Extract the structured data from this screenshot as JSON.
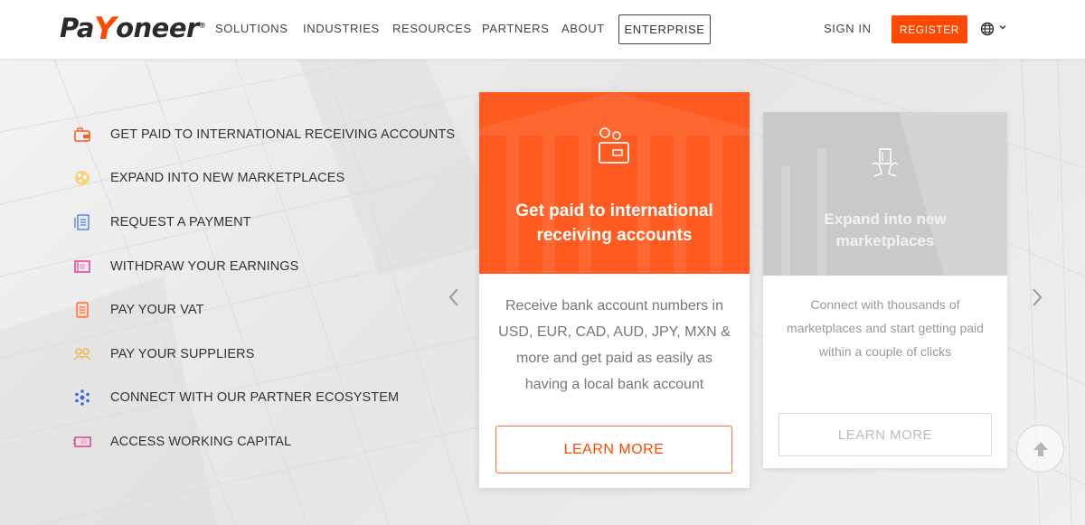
{
  "brand": {
    "logo_prefix": "Pa",
    "logo_y": "Y",
    "logo_suffix": "oneer",
    "logo_reg": "®",
    "accent": "#ff4800",
    "card_orange": "#ff5a1f",
    "card_grey": "#c9c9cb"
  },
  "nav": {
    "items": [
      "SOLUTIONS",
      "INDUSTRIES",
      "RESOURCES",
      "PARTNERS",
      "ABOUT"
    ],
    "enterprise": "ENTERPRISE",
    "sign_in": "SIGN IN",
    "register": "REGISTER",
    "language_icon": "globe-icon"
  },
  "solutions": [
    {
      "label": "GET PAID TO INTERNATIONAL RECEIVING ACCOUNTS",
      "icon": "wallet-icon",
      "color": "#ff5a1f"
    },
    {
      "label": "EXPAND INTO NEW MARKETPLACES",
      "icon": "globe-dots-icon",
      "color": "#f5b73b"
    },
    {
      "label": "REQUEST A PAYMENT",
      "icon": "document-request-icon",
      "color": "#5b7fd6"
    },
    {
      "label": "WITHDRAW YOUR EARNINGS",
      "icon": "withdraw-icon",
      "color": "#e0418f"
    },
    {
      "label": "PAY YOUR VAT",
      "icon": "receipt-icon",
      "color": "#ff6a35"
    },
    {
      "label": "PAY YOUR SUPPLIERS",
      "icon": "suppliers-icon",
      "color": "#f5b73b"
    },
    {
      "label": "CONNECT WITH OUR PARTNER ECOSYSTEM",
      "icon": "network-icon",
      "color": "#3b6cd6"
    },
    {
      "label": "ACCESS WORKING CAPITAL",
      "icon": "cash-icon",
      "color": "#e0418f"
    }
  ],
  "cards": {
    "main": {
      "title": "Get paid to international receiving accounts",
      "description": "Receive bank account numbers in USD, EUR, CAD, AUD, JPY, MXN & more and get paid as easily as having a local bank account",
      "cta": "LEARN MORE",
      "icon": "wallet-icon"
    },
    "side": {
      "title": "Expand into new marketplaces",
      "description": "Connect with thousands of marketplaces and start getting paid within a couple of clicks",
      "cta": "LEARN MORE",
      "icon": "marketplace-hands-icon"
    }
  },
  "carousel": {
    "prev_icon": "chevron-left-icon",
    "next_icon": "chevron-right-icon"
  },
  "scroll_top_icon": "arrow-up-icon"
}
